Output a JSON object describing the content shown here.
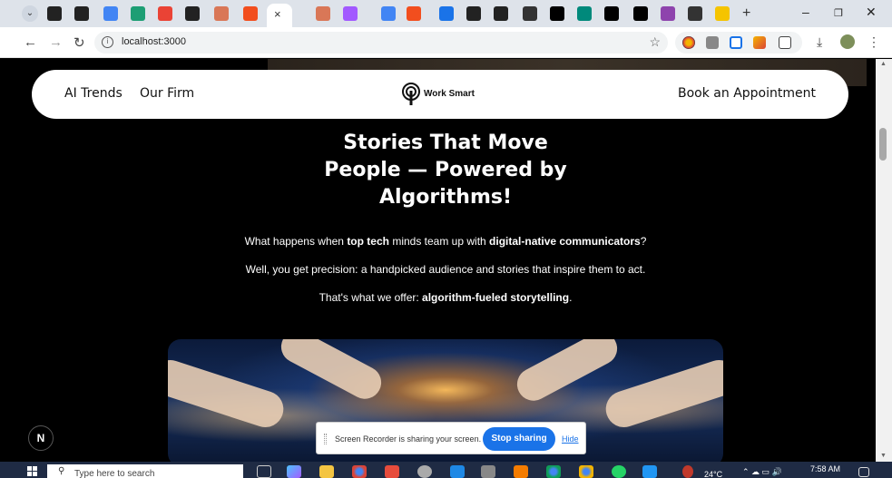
{
  "browser": {
    "tab_search_icon": "chevron-down-icon",
    "tabs": [
      {
        "icon": "chatgpt-icon",
        "color": "#222"
      },
      {
        "icon": "github-icon",
        "color": "#222"
      },
      {
        "icon": "google-icon",
        "color": "#4285f4"
      },
      {
        "icon": "perplexity-icon",
        "color": "#1d9e74"
      },
      {
        "icon": "gmail-icon",
        "color": "#ea4335"
      },
      {
        "icon": "github-icon",
        "color": "#222"
      },
      {
        "icon": "claude-icon",
        "color": "#d97757"
      },
      {
        "icon": "figma-icon",
        "color": "#f24e1e"
      },
      {
        "icon": "figma-icon",
        "color": "#f24e1e"
      },
      {
        "icon": "claude-icon",
        "color": "#d97757"
      },
      {
        "icon": "figma-icon",
        "color": "#a259ff"
      },
      {
        "icon": "google-icon",
        "color": "#4285f4"
      },
      {
        "icon": "figma-icon",
        "color": "#f24e1e"
      },
      {
        "icon": "image-icon",
        "color": "#1a73e8"
      },
      {
        "icon": "chatgpt-icon",
        "color": "#222"
      },
      {
        "icon": "chatgpt-icon",
        "color": "#222"
      },
      {
        "icon": "shield-icon",
        "color": "#333"
      },
      {
        "icon": "vercel-icon",
        "color": "#000"
      },
      {
        "icon": "meet-icon",
        "color": "#00897b"
      },
      {
        "icon": "vercel-icon",
        "color": "#000"
      },
      {
        "icon": "vercel-icon",
        "color": "#000"
      },
      {
        "icon": "bracket-icon",
        "color": "#8e44ad"
      },
      {
        "icon": "shield-icon",
        "color": "#333"
      },
      {
        "icon": "badge-icon",
        "color": "#f5c400"
      }
    ],
    "active_tab_close": "×",
    "new_tab": "+",
    "window_controls": {
      "minimize": "–",
      "restore": "❐",
      "close": "✕"
    },
    "nav": {
      "back": "←",
      "forward": "→",
      "reload": "↻"
    },
    "url": "localhost:3000",
    "omnibox_info": "i",
    "bookmark_star": "☆"
  },
  "site": {
    "nav": {
      "ai_trends": "AI Trends",
      "our_firm": "Our Firm",
      "logo_text": "Work Smart",
      "book": "Book an Appointment"
    },
    "headline": [
      "Stories That Move",
      "People — Powered by",
      "Algorithms!"
    ],
    "paragraphs": {
      "p1": {
        "a": "What happens when ",
        "b": "top tech",
        "c": " minds team up with ",
        "d": "digital-native communicators",
        "e": "?"
      },
      "p2": "Well, you get precision: a handpicked audience and stories that inspire them to act.",
      "p3": {
        "a": "That's what we offer: ",
        "b": "algorithm-fueled storytelling",
        "c": "."
      }
    },
    "next_badge": "N"
  },
  "screen_share": {
    "message": "Screen Recorder is sharing your screen.",
    "stop": "Stop sharing",
    "hide": "Hide"
  },
  "taskbar": {
    "search_placeholder": "Type here to search",
    "temperature": "24°C",
    "time": "7:58 AM"
  }
}
